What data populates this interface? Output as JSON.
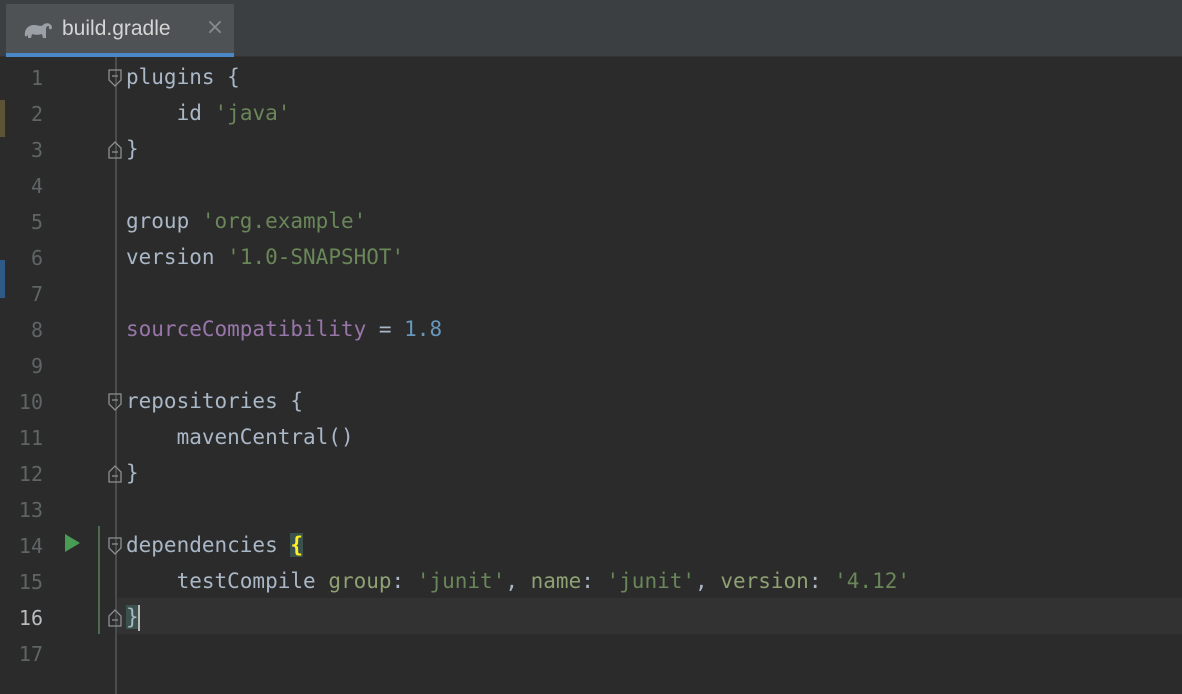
{
  "editor": {
    "tab": {
      "label": "build.gradle",
      "icon": "gradle-elephant-icon",
      "close_glyph": "×"
    },
    "current_line": 16,
    "line_numbers": [
      "1",
      "2",
      "3",
      "4",
      "5",
      "6",
      "7",
      "8",
      "9",
      "10",
      "11",
      "12",
      "13",
      "14",
      "15",
      "16",
      "17"
    ],
    "lines": {
      "l1": {
        "kw": "plugins",
        "brace": " {"
      },
      "l2": {
        "indent": "    ",
        "kw": "id",
        "str": "'java'"
      },
      "l3": {
        "brace": "}"
      },
      "l5": {
        "kw": "group",
        "str": "'org.example'"
      },
      "l6": {
        "kw": "version",
        "str": "'1.0-SNAPSHOT'"
      },
      "l8": {
        "prop": "sourceCompatibility",
        "op": " = ",
        "num": "1.8"
      },
      "l10": {
        "kw": "repositories",
        "brace": " {"
      },
      "l11": {
        "indent": "    ",
        "call": "mavenCentral()"
      },
      "l12": {
        "brace": "}"
      },
      "l14": {
        "kw": "dependencies",
        "brace": "{"
      },
      "l15": {
        "indent": "    ",
        "call": "testCompile",
        "p1": "group",
        "v1": "'junit'",
        "p2": "name",
        "v2": "'junit'",
        "p3": "version",
        "v3": "'4.12'"
      },
      "l16": {
        "brace": "}"
      }
    },
    "colors": {
      "background": "#2b2b2b",
      "string": "#6a8759",
      "property": "#9876aa",
      "number": "#6897bb",
      "plain": "#a9b7c6",
      "brace_highlight": "#ffef28",
      "run_icon": "#499c54"
    }
  }
}
